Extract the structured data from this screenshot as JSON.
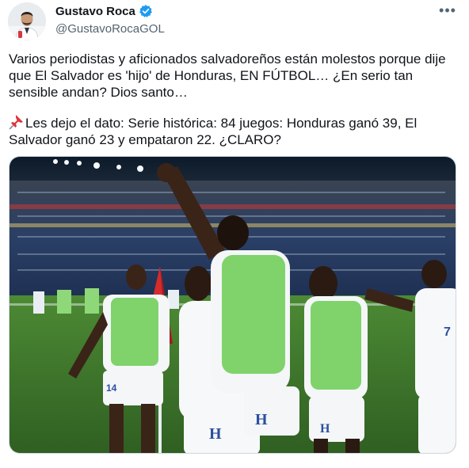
{
  "tweet": {
    "author": {
      "display_name": "Gustavo Roca",
      "handle": "@GustavoRocaGOL",
      "verified": true,
      "verified_color": "#1d9bf0"
    },
    "more_label": "•••",
    "paragraph_1": "Varios periodistas y aficionados salvadoreños están molestos porque dije que El Salvador es 'hijo' de Honduras, EN FÚTBOL… ¿En serio tan sensible andan? Dios santo…",
    "paragraph_2_emoji": "pushpin-icon",
    "paragraph_2": "Les dejo el dato: Serie histórica: 84 juegos: Honduras ganó 39, El Salvador ganó 23 y empataron 22. ¿CLARO?",
    "media": {
      "jersey_text": "H",
      "jersey_numbers": [
        "14",
        "7"
      ]
    }
  },
  "colors": {
    "text_primary": "#0f1419",
    "text_secondary": "#536471",
    "verified": "#1d9bf0",
    "pitch": "#3f7a2a",
    "bib_green": "#7fd36a",
    "flag_red": "#d62b2b"
  }
}
